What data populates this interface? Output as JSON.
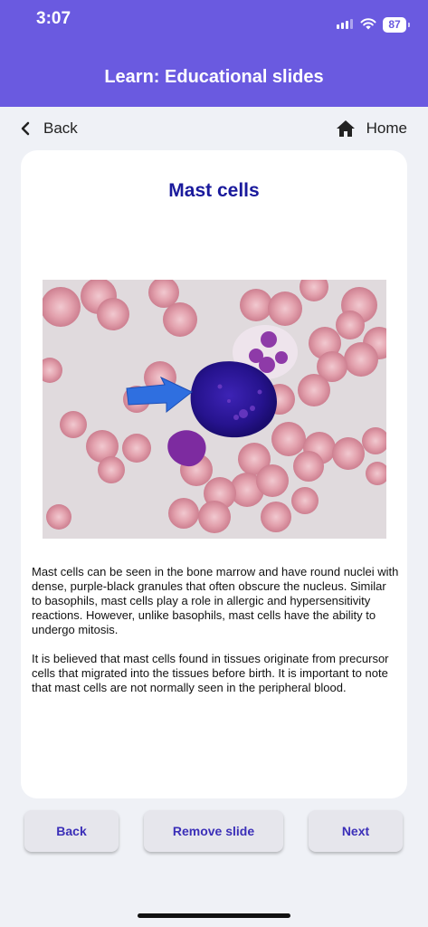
{
  "status_bar": {
    "time": "3:07",
    "battery": "87"
  },
  "header": {
    "title": "Learn: Educational slides"
  },
  "nav": {
    "back_label": "Back",
    "home_label": "Home"
  },
  "slide": {
    "title": "Mast cells",
    "paragraphs": [
      "Mast cells can be seen in the bone marrow and have round nuclei with dense, purple-black granules that often obscure the nucleus. Similar to basophils, mast cells play a role in allergic and hypersensitivity reactions. However, unlike basophils, mast cells have the ability to undergo mitosis.",
      "It is believed that mast cells found in tissues originate from precursor cells that migrated into the tissues before birth. It is important to note that mast cells are not normally seen in the peripheral blood."
    ]
  },
  "buttons": {
    "back": "Back",
    "remove": "Remove slide",
    "next": "Next"
  },
  "colors": {
    "header": "#6a5ae0",
    "title": "#1a1a9c",
    "button_text": "#3b2fb8",
    "arrow": "#2f6fe0"
  },
  "icons": {
    "back": "chevron-left-icon",
    "home": "home-icon",
    "arrow": "arrow-right-icon"
  }
}
